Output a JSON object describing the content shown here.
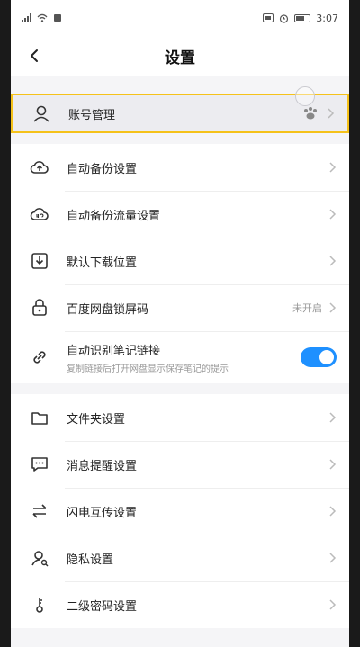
{
  "status_bar": {
    "time": "3:07"
  },
  "nav": {
    "title": "设置"
  },
  "rows": [
    {
      "label": "账号管理"
    },
    {
      "label": "自动备份设置"
    },
    {
      "label": "自动备份流量设置"
    },
    {
      "label": "默认下载位置"
    },
    {
      "label": "百度网盘锁屏码",
      "status": "未开启"
    },
    {
      "label": "自动识别笔记链接",
      "sub": "复制链接后打开网盘显示保存笔记的提示",
      "toggle_on": true
    },
    {
      "label": "文件夹设置"
    },
    {
      "label": "消息提醒设置"
    },
    {
      "label": "闪电互传设置"
    },
    {
      "label": "隐私设置"
    },
    {
      "label": "二级密码设置"
    }
  ],
  "colors": {
    "accent": "#1e90ff",
    "highlight_border": "#f5c21a"
  }
}
